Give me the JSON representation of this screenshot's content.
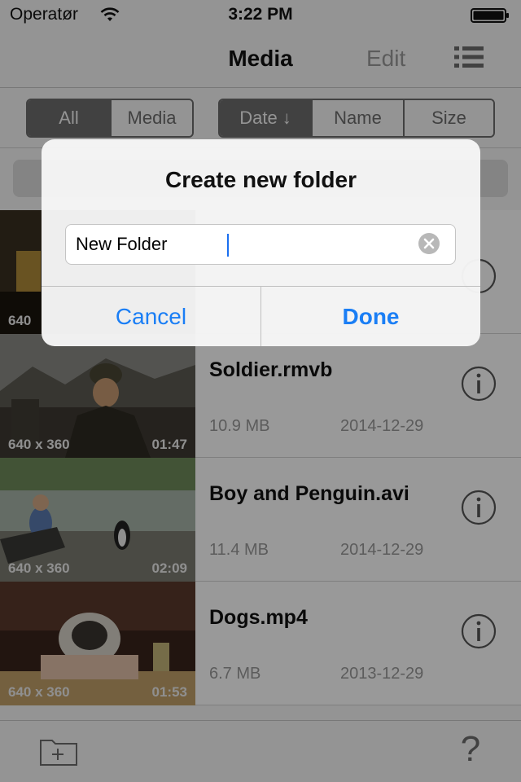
{
  "status_bar": {
    "carrier": "Operatør",
    "time": "3:22 PM"
  },
  "nav": {
    "title": "Media",
    "edit_label": "Edit"
  },
  "filter": {
    "type_segments": [
      "All",
      "Media"
    ],
    "sort_segments": [
      "Date ↓",
      "Name",
      "Size"
    ]
  },
  "rows": [
    {
      "name": "",
      "size": "",
      "date": "",
      "resolution": "640",
      "duration": ""
    },
    {
      "name": "Soldier.rmvb",
      "size": "10.9 MB",
      "date": "2014-12-29",
      "resolution": "640 x 360",
      "duration": "01:47"
    },
    {
      "name": "Boy and Penguin.avi",
      "size": "11.4 MB",
      "date": "2014-12-29",
      "resolution": "640 x 360",
      "duration": "02:09"
    },
    {
      "name": "Dogs.mp4",
      "size": "6.7 MB",
      "date": "2013-12-29",
      "resolution": "640 x 360",
      "duration": "01:53"
    }
  ],
  "toolbar": {
    "help_label": "?"
  },
  "alert": {
    "title": "Create new folder",
    "input_value": "New Folder",
    "cancel_label": "Cancel",
    "done_label": "Done"
  },
  "colors": {
    "accent": "#1a7ef5",
    "segment_active": "#6d6d6d"
  }
}
